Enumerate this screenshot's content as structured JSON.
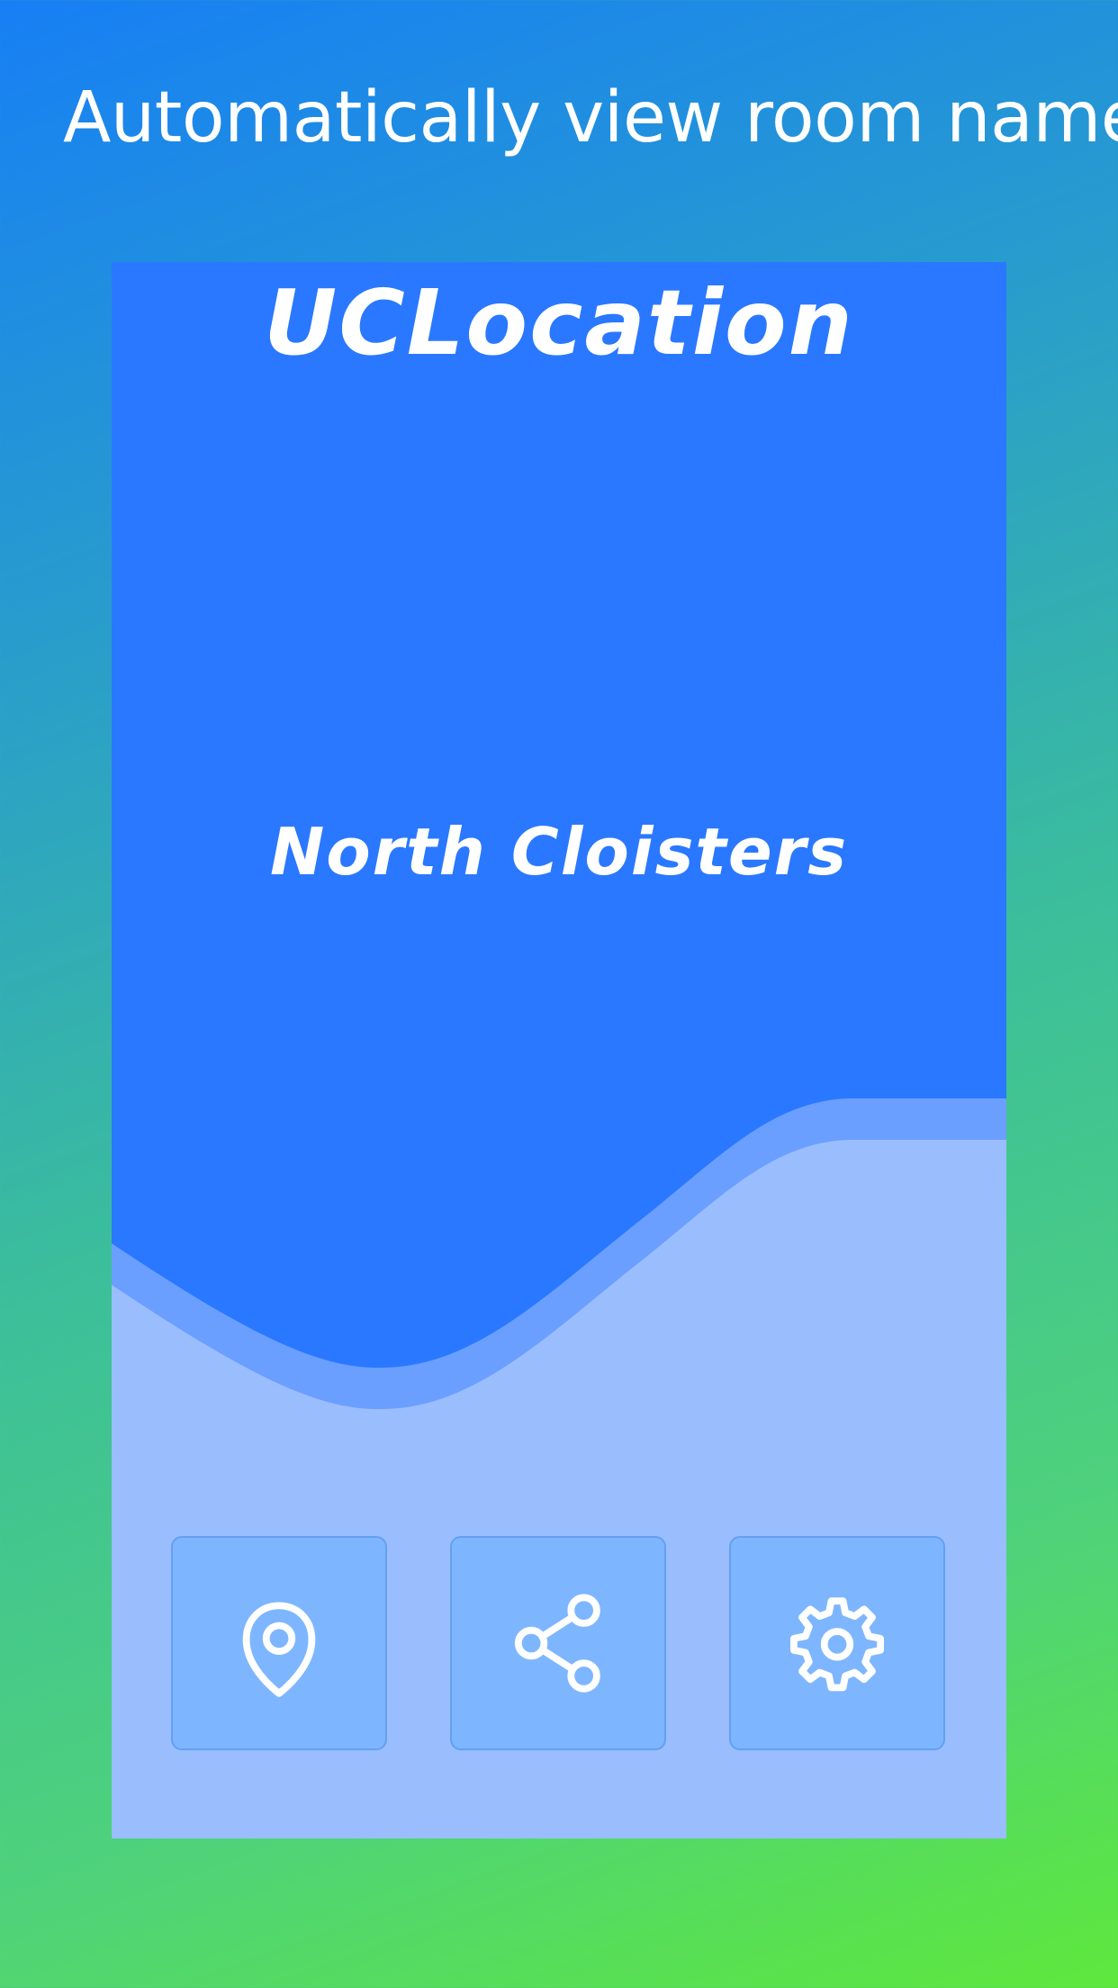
{
  "caption": "Automatically view room name",
  "app": {
    "title": "UCLocation",
    "room_name": "North Cloisters"
  },
  "actions": [
    {
      "icon": "location-pin-icon"
    },
    {
      "icon": "share-icon"
    },
    {
      "icon": "settings-gear-icon"
    }
  ],
  "colors": {
    "header_blue": "#2a78ff",
    "wave_mid": "#6a9fff",
    "wave_light": "#9abdfe",
    "button_fill": "#7db6ff",
    "background_top": "#177ff5",
    "background_bottom": "#5ee83c"
  }
}
